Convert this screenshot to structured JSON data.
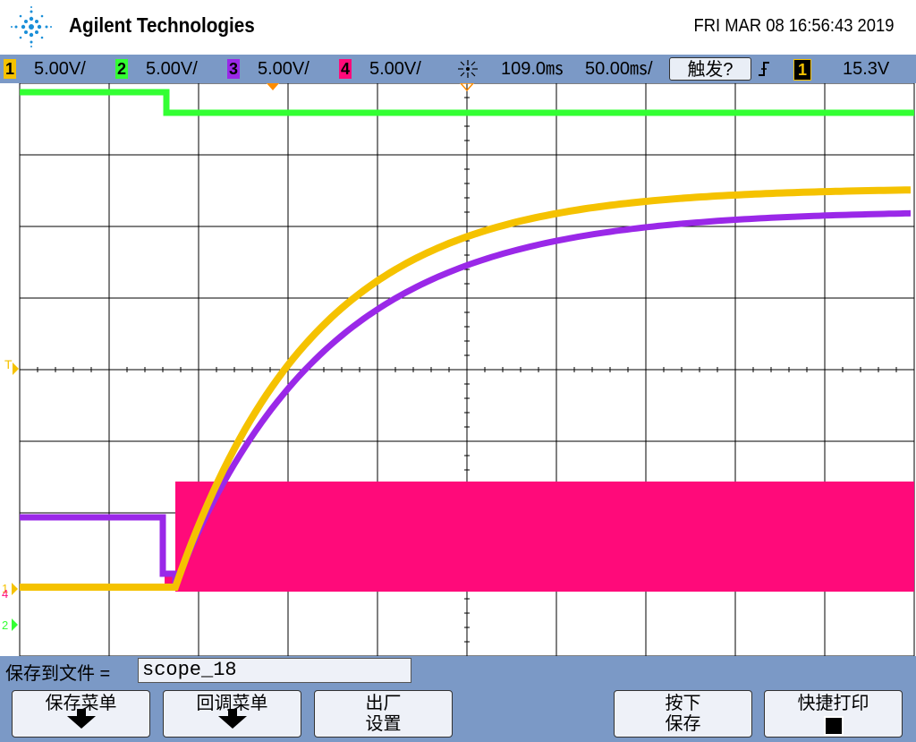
{
  "header": {
    "brand": "Agilent Technologies",
    "datetime": "FRI MAR 08 16:56:43 2019"
  },
  "status_bar": {
    "channels": [
      {
        "num": "1",
        "scale": "5.00V/",
        "color": "#f5c200"
      },
      {
        "num": "2",
        "scale": "5.00V/",
        "color": "#33ff33"
      },
      {
        "num": "3",
        "scale": "5.00V/",
        "color": "#9a28e8"
      },
      {
        "num": "4",
        "scale": "5.00V/",
        "color": "#ff0a7a"
      }
    ],
    "time_delay": "109.0㎳",
    "time_scale": "50.00㎳/",
    "trigger_button": "触发?",
    "trigger_slope_icon": "rising-edge-icon",
    "trigger_channel": "1",
    "trigger_level": "15.3V"
  },
  "markers": {
    "trigger_marker": "T",
    "ch1_ground": "1",
    "ch2_ground": "2",
    "ch4_ground": "4"
  },
  "softkeys": {
    "save_label": "保存到文件 =",
    "filename": "scope_18",
    "save_menu": "保存菜单",
    "recall_menu": "回调菜单",
    "factory_setup_l1": "出厂",
    "factory_setup_l2": "设置",
    "press_save_l1": "按下",
    "press_save_l2": "保存",
    "quick_print": "快捷打印"
  },
  "colors": {
    "grid": "#000000",
    "ch1": "#f5c200",
    "ch2": "#33ff33",
    "ch3": "#9a28e8",
    "ch4": "#ff0a7a",
    "chrome": "#7b99c6"
  }
}
